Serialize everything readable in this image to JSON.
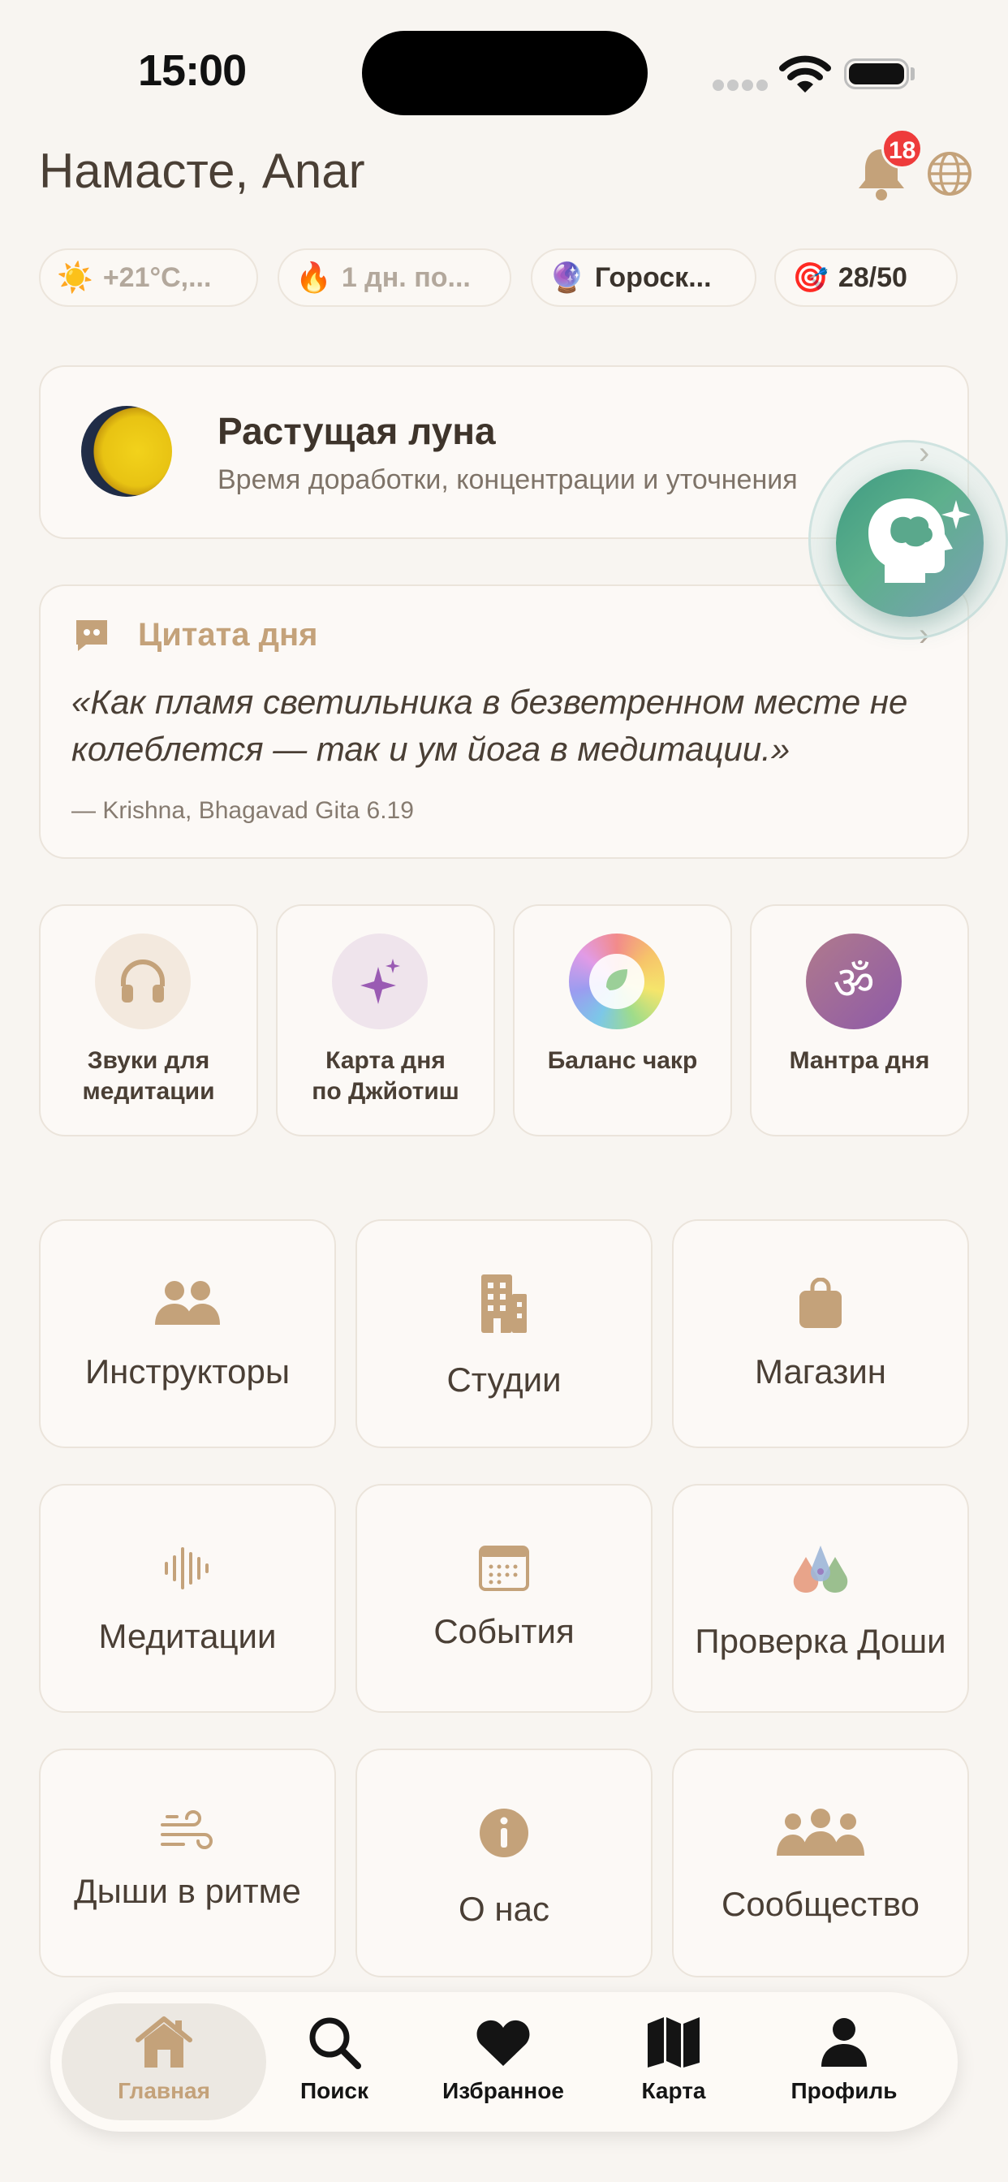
{
  "status_bar": {
    "time": "15:00"
  },
  "header": {
    "greeting": "Намасте, Anar",
    "notifications_count": "18"
  },
  "chips": [
    {
      "emoji": "☀️",
      "label": "+21°C,..."
    },
    {
      "emoji": "🔥",
      "label": "1 дн. по..."
    },
    {
      "emoji": "🔮",
      "label": "Гороск..."
    },
    {
      "emoji": "🎯",
      "label": "28/50"
    }
  ],
  "moon": {
    "title": "Растущая луна",
    "subtitle": "Время доработки, концентрации и уточнения"
  },
  "quote": {
    "heading": "Цитата дня",
    "text": "«Как пламя светильника в безветренном месте не колеблется — так и ум йога в медитации.»",
    "author": "— Krishna, Bhagavad Gita 6.19"
  },
  "quick_tiles": [
    {
      "label": "Звуки для\nмедитации",
      "icon": "headphones-icon"
    },
    {
      "label": "Карта дня\nпо Джйотиш",
      "icon": "sparkles-icon"
    },
    {
      "label": "Баланс чакр",
      "icon": "leaf-icon"
    },
    {
      "label": "Мантра дня",
      "icon": "om-icon"
    }
  ],
  "grid": [
    {
      "label": "Инструкторы",
      "icon": "users-icon"
    },
    {
      "label": "Студии",
      "icon": "building-icon"
    },
    {
      "label": "Магазин",
      "icon": "shopping-bag-icon"
    },
    {
      "label": "Медитации",
      "icon": "waveform-icon"
    },
    {
      "label": "События",
      "icon": "calendar-icon"
    },
    {
      "label": "Проверка Доши",
      "icon": "dosha-drops-icon"
    },
    {
      "label": "Дыши в ритме",
      "icon": "wind-icon"
    },
    {
      "label": "О нас",
      "icon": "info-icon"
    },
    {
      "label": "Сообщество",
      "icon": "community-icon"
    }
  ],
  "tabs": [
    {
      "label": "Главная",
      "icon": "home-icon",
      "active": true
    },
    {
      "label": "Поиск",
      "icon": "search-icon"
    },
    {
      "label": "Избранное",
      "icon": "heart-icon"
    },
    {
      "label": "Карта",
      "icon": "map-icon"
    },
    {
      "label": "Профиль",
      "icon": "person-icon"
    }
  ],
  "colors": {
    "accent": "#c4a27a",
    "background": "#f8f5f1",
    "badge": "#ee3b3b"
  }
}
